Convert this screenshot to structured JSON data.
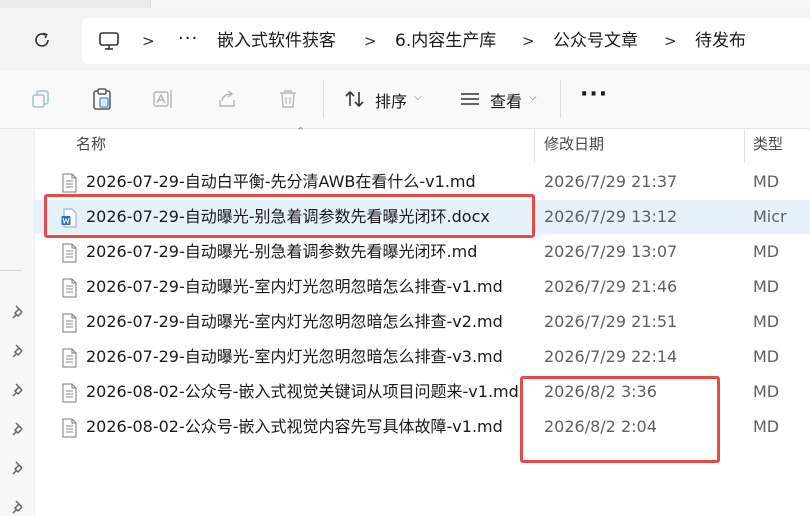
{
  "address_bar": {
    "overflow": "···",
    "crumbs": [
      "嵌入式软件获客",
      "6.内容生产库",
      "公众号文章",
      "待发布"
    ],
    "separator": ">"
  },
  "toolbar": {
    "sort_label": "排序",
    "view_label": "查看",
    "more_label": "···"
  },
  "columns": {
    "name": "名称",
    "date_modified": "修改日期",
    "type": "类型"
  },
  "files": [
    {
      "name": "2026-07-29-自动白平衡-先分清AWB在看什么-v1.md",
      "date": "2026/7/29 21:37",
      "type": "MD",
      "icon": "text-file-icon"
    },
    {
      "name": "2026-07-29-自动曝光-别急着调参数先看曝光闭环.docx",
      "date": "2026/7/29 13:12",
      "type": "Micr",
      "icon": "word-doc-icon"
    },
    {
      "name": "2026-07-29-自动曝光-别急着调参数先看曝光闭环.md",
      "date": "2026/7/29 13:07",
      "type": "MD",
      "icon": "text-file-icon"
    },
    {
      "name": "2026-07-29-自动曝光-室内灯光忽明忽暗怎么排查-v1.md",
      "date": "2026/7/29 21:46",
      "type": "MD",
      "icon": "text-file-icon"
    },
    {
      "name": "2026-07-29-自动曝光-室内灯光忽明忽暗怎么排查-v2.md",
      "date": "2026/7/29 21:51",
      "type": "MD",
      "icon": "text-file-icon"
    },
    {
      "name": "2026-07-29-自动曝光-室内灯光忽明忽暗怎么排查-v3.md",
      "date": "2026/7/29 22:14",
      "type": "MD",
      "icon": "text-file-icon"
    },
    {
      "name": "2026-08-02-公众号-嵌入式视觉关键词从项目问题来-v1.md",
      "date": "2026/8/2 3:36",
      "type": "MD",
      "icon": "text-file-icon"
    },
    {
      "name": "2026-08-02-公众号-嵌入式视觉内容先写具体故障-v1.md",
      "date": "2026/8/2 2:04",
      "type": "MD",
      "icon": "text-file-icon"
    }
  ],
  "colors": {
    "annotation": "#e84a4a",
    "selection": "#e6f1fb",
    "word_blue": "#2b6cc4"
  }
}
